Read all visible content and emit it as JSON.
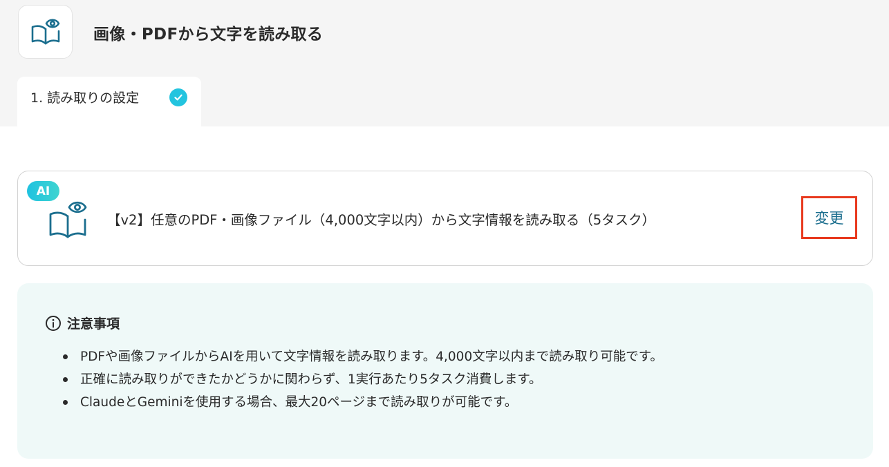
{
  "header": {
    "app_icon": "open-book-with-eye-icon",
    "title": "画像・PDFから文字を読み取る"
  },
  "tabs": [
    {
      "label": "1. 読み取りの設定",
      "status_icon": "check-circle-icon",
      "status": "completed",
      "active": true
    }
  ],
  "action_card": {
    "badge": "AI",
    "icon": "open-book-with-eye-icon",
    "description": "【v2】任意のPDF・画像ファイル（4,000文字以内）から文字情報を読み取る（5タスク）",
    "change_button_label": "変更"
  },
  "notice": {
    "icon": "info-icon",
    "title": "注意事項",
    "items": [
      "PDFや画像ファイルからAIを用いて文字情報を読み取ります。4,000文字以内まで読み取り可能です。",
      "正確に読み取りができたかどうかに関わらず、1実行あたり5タスク消費します。",
      "ClaudeとGeminiを使用する場合、最大20ページまで読み取りが可能です。"
    ]
  },
  "colors": {
    "accent_teal": "#1b6e8e",
    "check_cyan": "#23c4df",
    "highlight_red": "#e8391e",
    "notice_bg": "#eff9f8",
    "header_bg": "#f5f5f5"
  }
}
